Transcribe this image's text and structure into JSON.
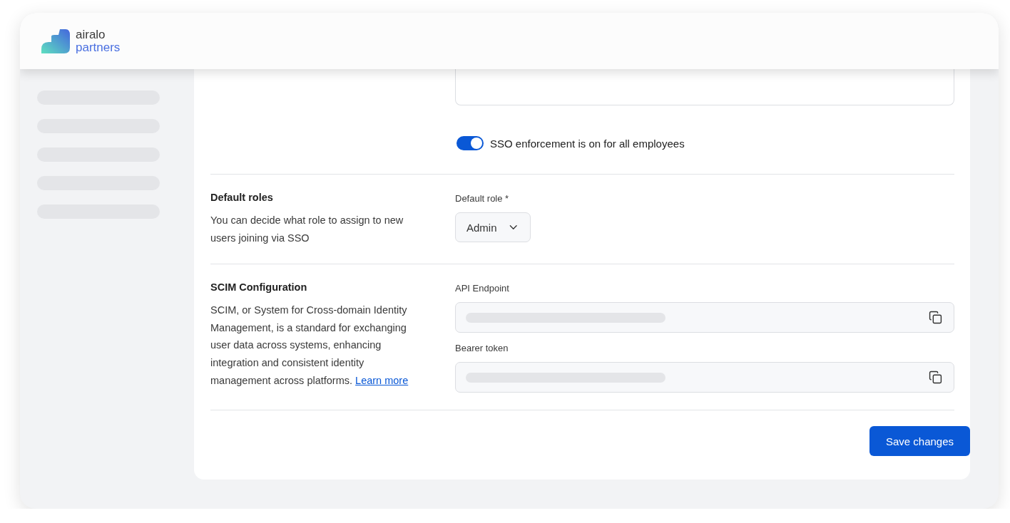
{
  "brand": {
    "name": "airalo",
    "sub": "partners"
  },
  "sso_toggle": {
    "on": true,
    "label": "SSO enforcement is on for all employees"
  },
  "sections": [
    {
      "kind": "select",
      "title": "Default roles",
      "description": "You can decide what role to assign to new users joining via SSO",
      "fields": [
        {
          "label": "Default role *",
          "value": "Admin"
        }
      ]
    },
    {
      "kind": "copy",
      "title": "SCIM Configuration",
      "description": "SCIM, or System for Cross-domain Identity Management, is a standard for exchanging user data across systems, enhancing integration and consistent identity management across platforms.",
      "link": "Learn more",
      "fields": [
        {
          "label": "API Endpoint"
        },
        {
          "label": "Bearer token"
        }
      ]
    }
  ],
  "save_button": "Save changes"
}
